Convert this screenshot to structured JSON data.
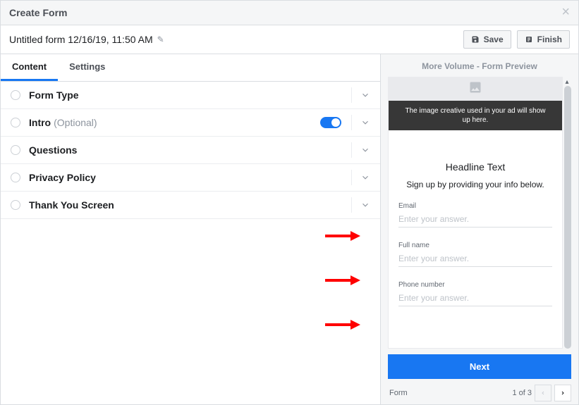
{
  "titlebar": {
    "title": "Create Form"
  },
  "form": {
    "name": "Untitled form 12/16/19, 11:50 AM"
  },
  "actions": {
    "save": "Save",
    "finish": "Finish"
  },
  "tabs": {
    "content": "Content",
    "settings": "Settings"
  },
  "sections": {
    "form_type": "Form Type",
    "intro": "Intro",
    "intro_optional": "(Optional)",
    "questions": "Questions",
    "privacy": "Privacy Policy",
    "thank_you": "Thank You Screen"
  },
  "preview": {
    "header": "More Volume - Form Preview",
    "banner": "The image creative used in your ad will show up here.",
    "headline": "Headline Text",
    "subhead": "Sign up by providing your info below.",
    "fields": {
      "email_label": "Email",
      "email_ph": "Enter your answer.",
      "name_label": "Full name",
      "name_ph": "Enter your answer.",
      "phone_label": "Phone number",
      "phone_ph": "Enter your answer."
    },
    "next": "Next",
    "pager_label": "Form",
    "pager_pos": "1 of 3"
  }
}
